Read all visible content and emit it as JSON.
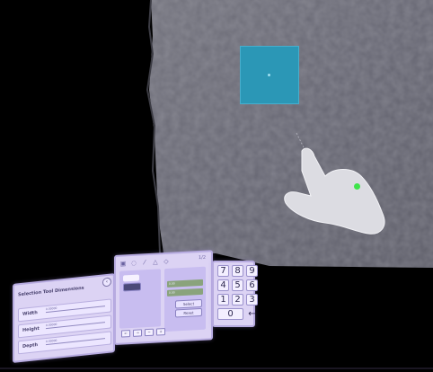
{
  "scene": {
    "background_color": "#000000",
    "mesh_color": "#6f6f79",
    "cube_color": "#2b97b6",
    "pointer_dot_color": "#3ee44a",
    "panel_color": "#dcd3f4"
  },
  "dimension_panel": {
    "title": "Selection Tool Dimensions",
    "back_icon": "chevron-left-icon",
    "rows": [
      {
        "label": "Width",
        "value": "0.00000"
      },
      {
        "label": "Height",
        "value": "0.00000"
      },
      {
        "label": "Depth",
        "value": "0.00000"
      }
    ]
  },
  "tool_panel": {
    "icons": [
      "cube-icon",
      "circle-icon",
      "brush-icon",
      "flask-icon",
      "shape-icon"
    ],
    "counter": "1/2",
    "fields": [
      "0.00",
      "0.00"
    ],
    "buttons": [
      "Select",
      "Reset"
    ],
    "bottom_buttons": [
      "←",
      "→",
      "−",
      "+"
    ]
  },
  "numpad": {
    "keys": [
      "7",
      "8",
      "9",
      "4",
      "5",
      "6",
      "1",
      "2",
      "3",
      "0",
      "←"
    ],
    "backspace_icon": "backspace-arrow-icon"
  }
}
